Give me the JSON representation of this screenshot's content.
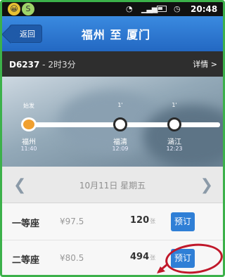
{
  "status_bar": {
    "app_icon_1": "😀",
    "app_icon_2": "S",
    "time": "20:48"
  },
  "header": {
    "back_label": "返回",
    "title": "福州 至 厦门"
  },
  "train": {
    "number": "D6237",
    "duration": " - 2时3分",
    "detail_label": "详情 >"
  },
  "stops": [
    {
      "above": "始发",
      "name": "福州",
      "time": "11:40",
      "origin": true
    },
    {
      "above": "1'",
      "name": "福清",
      "time": "12:09",
      "origin": false
    },
    {
      "above": "1'",
      "name": "涵江",
      "time": "12:23",
      "origin": false
    }
  ],
  "date_bar": {
    "prev_icon": "chevron-left",
    "next_icon": "chevron-right",
    "date_text": "10月11日  星期五"
  },
  "seats": [
    {
      "class": "一等座",
      "price": "¥97.5",
      "count": "120",
      "unit": "张",
      "button": "预订"
    },
    {
      "class": "二等座",
      "price": "¥80.5",
      "count": "494",
      "unit": "张",
      "button": "预订"
    }
  ],
  "colors": {
    "header_blue": "#2f77d4",
    "button_blue": "#2f7fd6",
    "origin_orange": "#f0a030",
    "annotation_red": "#c0182a",
    "frame_green": "#3cb14a"
  }
}
